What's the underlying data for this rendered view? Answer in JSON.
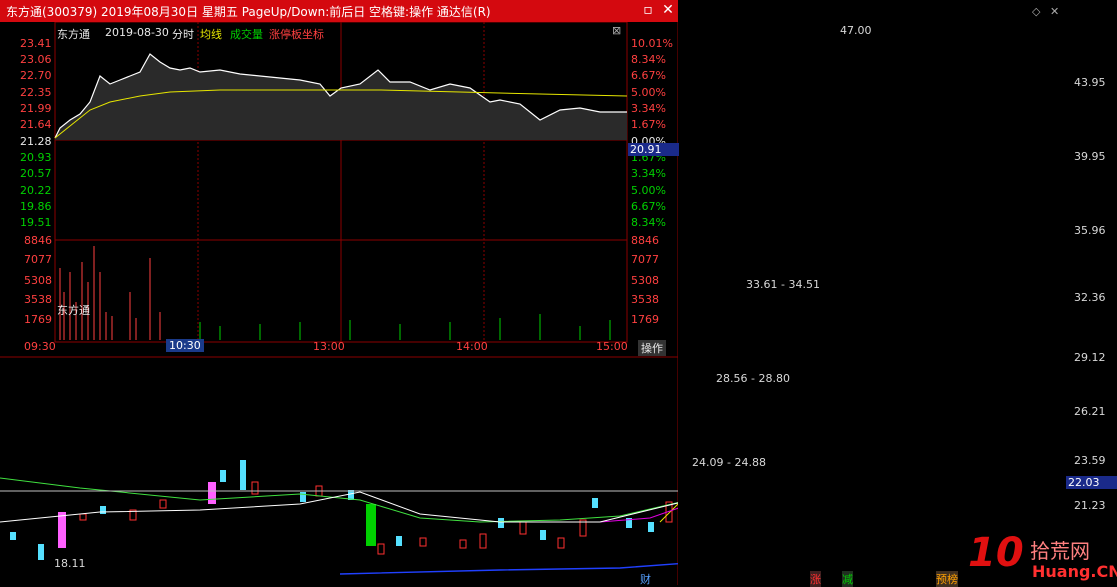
{
  "window": {
    "title": "东方通(300379) 2019年08月30日 星期五 PageUp/Down:前后日 空格键:操作 通达信(R)",
    "min_label": "▫",
    "close_label": "✕"
  },
  "minute_chart": {
    "stock_name": "东方通",
    "date": "2019-08-30",
    "mode": "分时",
    "avg_line_label": "均线",
    "volume_label": "成交量",
    "limit_label": "涨停板坐标",
    "prices_left": [
      "23.41",
      "23.06",
      "22.70",
      "22.35",
      "21.99",
      "21.64",
      "21.28",
      "20.93",
      "20.57",
      "20.22",
      "19.86",
      "19.51"
    ],
    "pct_right": [
      "10.01%",
      "8.34%",
      "6.67%",
      "5.00%",
      "3.34%",
      "1.67%",
      "0.00%",
      "1.67%",
      "3.34%",
      "5.00%",
      "6.67%",
      "8.34%"
    ],
    "vol_left": [
      "8846",
      "7077",
      "5308",
      "3538",
      "1769"
    ],
    "vol_right": [
      "8846",
      "7077",
      "5308",
      "3538",
      "1769"
    ],
    "current_price": "20.91",
    "times": [
      "09:30",
      "10:30",
      "13:00",
      "14:00",
      "15:00"
    ],
    "operate_label": "操作"
  },
  "kline": {
    "price_axis": [
      "43.95",
      "39.95",
      "35.96",
      "32.36",
      "29.12",
      "26.21",
      "23.59",
      "21.23"
    ],
    "high_label": "47.00",
    "low_label": "18.11",
    "gap_labels": [
      "33.61 - 34.51",
      "28.56 - 28.80",
      "24.09 - 24.88"
    ],
    "now_price": "22.03",
    "markers": [
      "财",
      "涨",
      "减",
      "预榜"
    ]
  },
  "watermark": {
    "number": "10",
    "text": "拾荒网",
    "domain": "Huang.CN"
  },
  "colors": {
    "titlebar": "#d4090f",
    "up": "#ff3030",
    "down": "#55e0ff",
    "grid": "#8b0000"
  }
}
